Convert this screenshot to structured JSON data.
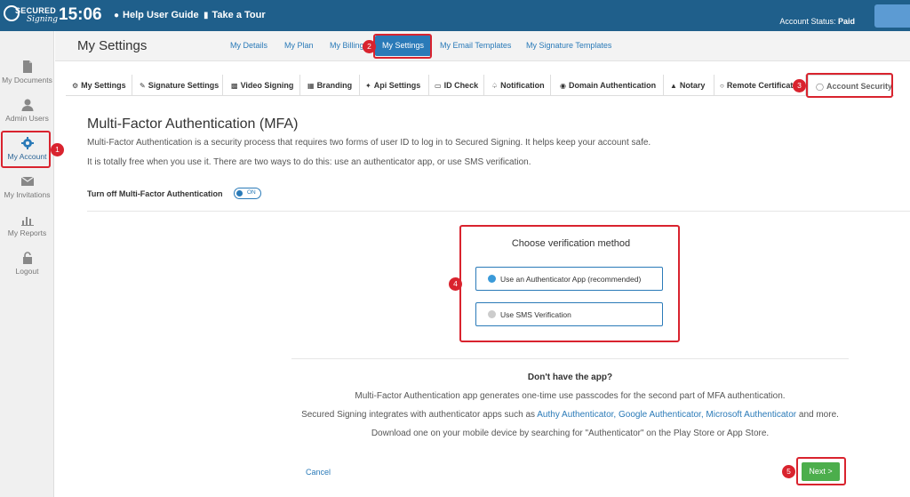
{
  "topbar": {
    "logo_line1": "SECURED",
    "logo_line2": "Signing",
    "clock": "15:06",
    "help_label": "Help User Guide",
    "tour_label": "Take a Tour",
    "account_status_label": "Account Status:",
    "account_status_value": "Paid"
  },
  "sidebar": {
    "items": [
      {
        "label": "My Documents",
        "icon": "document-icon"
      },
      {
        "label": "Admin Users",
        "icon": "user-icon"
      },
      {
        "label": "My Account",
        "icon": "gear-icon"
      },
      {
        "label": "My Invitations",
        "icon": "envelope-icon"
      },
      {
        "label": "My Reports",
        "icon": "bar-chart-icon"
      },
      {
        "label": "Logout",
        "icon": "lock-icon"
      }
    ]
  },
  "header": {
    "title": "My Settings",
    "tabs": [
      "My Details",
      "My Plan",
      "My Billing",
      "My Settings",
      "My Email Templates",
      "My Signature Templates"
    ]
  },
  "subtabs": [
    "My Settings",
    "Signature Settings",
    "Video Signing",
    "Branding",
    "Api Settings",
    "ID Check",
    "Notification",
    "Domain Authentication",
    "Notary",
    "Remote Certificat",
    "Account Security"
  ],
  "mfa": {
    "title": "Multi-Factor Authentication (MFA)",
    "desc1": "Multi-Factor Authentication is a security process that requires two forms of user ID to log in to Secured Signing. It helps keep your account safe.",
    "desc2": "It is totally free when you use it. There are two ways to do this: use an authenticator app, or use SMS verification.",
    "toggle_label": "Turn off Multi-Factor Authentication",
    "toggle_state": "ON"
  },
  "verification": {
    "title": "Choose verification method",
    "option_app": "Use an Authenticator App (recommended)",
    "option_sms": "Use SMS Verification"
  },
  "app_info": {
    "heading": "Don't have the app?",
    "line1": "Multi-Factor Authentication app generates one-time use passcodes for the second part of MFA authentication.",
    "line2_prefix": "Secured Signing integrates with authenticator apps such as",
    "authy": "Authy Authenticator,",
    "google": "Google Authenticator,",
    "microsoft": "Microsoft Authenticator",
    "line2_suffix": "and more.",
    "line3": "Download one on your mobile device by searching for \"Authenticator\" on the Play Store or App Store."
  },
  "footer": {
    "cancel": "Cancel",
    "next": "Next >"
  },
  "callouts": [
    "1",
    "2",
    "3",
    "4",
    "5"
  ],
  "colors": {
    "brand": "#1f5f8b",
    "accent": "#2a7ab8",
    "highlight": "#d9232e",
    "success": "#4cae4c"
  }
}
